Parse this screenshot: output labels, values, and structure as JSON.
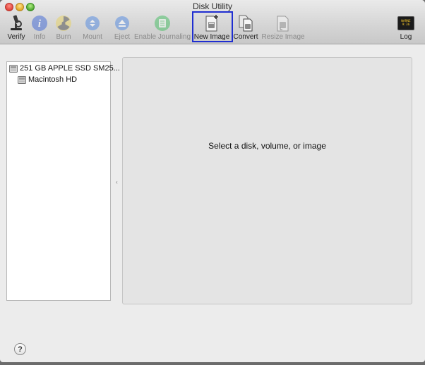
{
  "window": {
    "title": "Disk Utility"
  },
  "toolbar": {
    "verify": "Verify",
    "info": "Info",
    "burn": "Burn",
    "mount": "Mount",
    "eject": "Eject",
    "enable_journaling": "Enable Journaling",
    "new_image": "New Image",
    "convert": "Convert",
    "resize_image": "Resize Image",
    "log": "Log",
    "log_icon_text": "WARNI 9:36"
  },
  "sidebar": {
    "items": [
      {
        "label": "251 GB APPLE SSD SM25...",
        "icon": "hard-disk-icon"
      },
      {
        "label": "Macintosh HD",
        "icon": "volume-icon"
      }
    ]
  },
  "detail": {
    "message": "Select a disk, volume, or image"
  },
  "help": {
    "label": "?"
  }
}
